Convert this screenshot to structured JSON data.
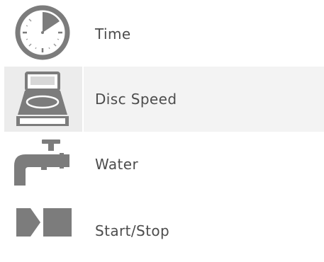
{
  "menu": {
    "items": [
      {
        "label": "Time",
        "icon": "clock-icon",
        "selected": false
      },
      {
        "label": "Disc Speed",
        "icon": "disc-speed-icon",
        "selected": true
      },
      {
        "label": "Water",
        "icon": "water-tap-icon",
        "selected": false
      },
      {
        "label": "Start/Stop",
        "icon": "start-stop-icon",
        "selected": false
      }
    ]
  },
  "colors": {
    "icon": "#7c7c7c",
    "icon_light": "#a0a0a0",
    "selected_icon_bg": "#ececec",
    "selected_label_bg": "#f3f3f3",
    "text": "#4c4c4c"
  }
}
